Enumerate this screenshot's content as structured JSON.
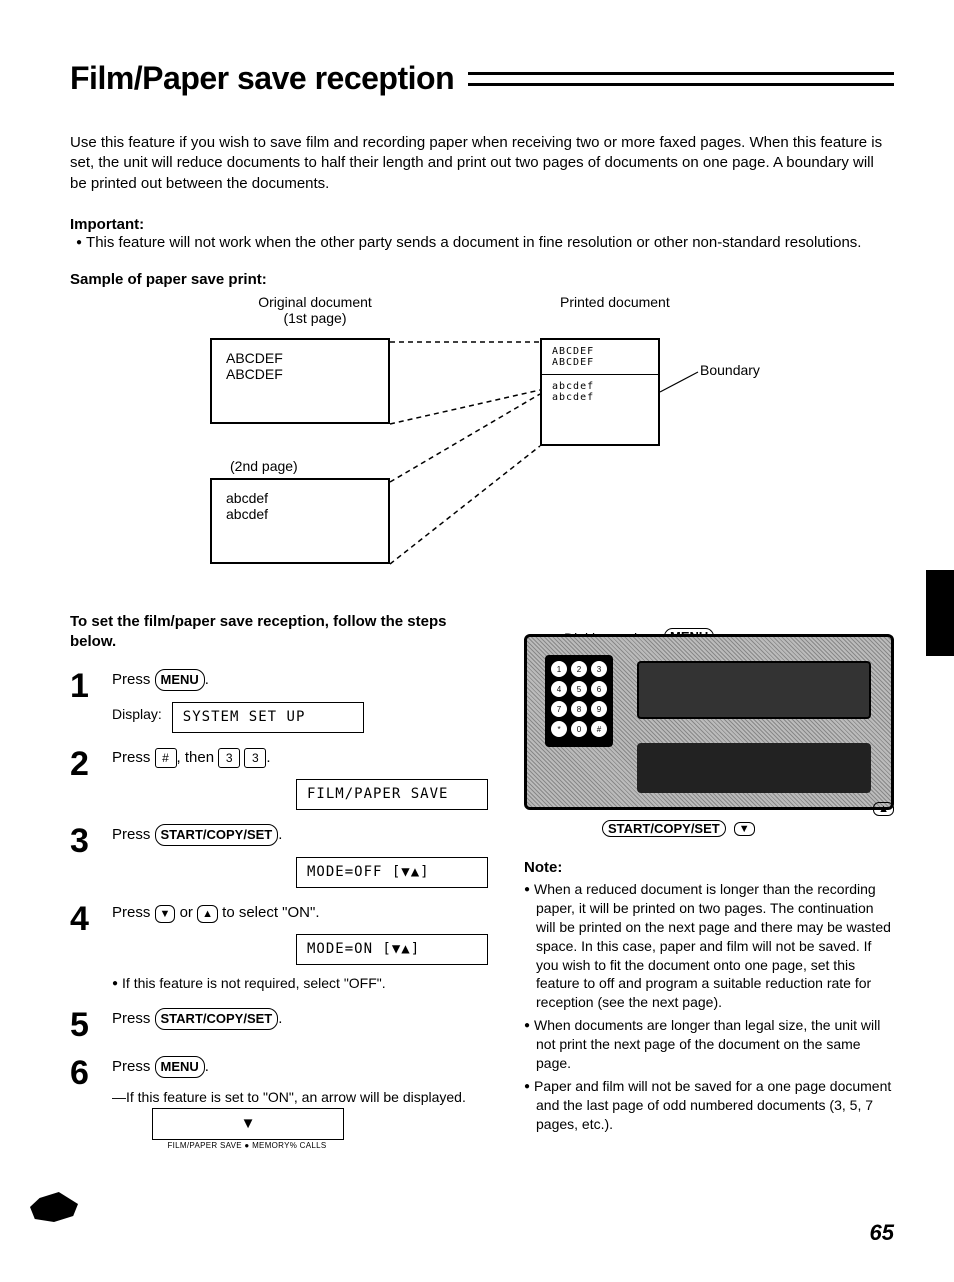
{
  "title": "Film/Paper save reception",
  "intro": "Use this feature if you wish to save film and recording paper when receiving two or more faxed pages. When this feature is set, the unit will reduce documents to half their length and print out two pages of documents on one page. A boundary will be printed out between the documents.",
  "important": {
    "label": "Important:",
    "body": "This feature will not work when the other party sends a document in fine resolution or other non-standard resolutions."
  },
  "sample": {
    "label": "Sample of paper save print:",
    "original_label": "Original document\n(1st page)",
    "printed_label": "Printed document",
    "page2_label": "(2nd page)",
    "box1_l1": "ABCDEF",
    "box1_l2": "ABCDEF",
    "box2_l1": "abcdef",
    "box2_l2": "abcdef",
    "pbox_top1": "ABCDEF",
    "pbox_top2": "ABCDEF",
    "pbox_bot1": "abcdef",
    "pbox_bot2": "abcdef",
    "boundary_label": "Boundary"
  },
  "steps_intro": "To set the film/paper save reception, follow the steps below.",
  "buttons": {
    "menu": "MENU",
    "hash": "#",
    "three": "3",
    "startcopyset": "START/COPY/SET",
    "down": "▼",
    "up": "▲"
  },
  "steps": {
    "s1": {
      "num": "1",
      "text_pre": "Press ",
      "btn": "menu",
      "text_post": ".",
      "display_label": "Display:",
      "lcd": "SYSTEM SET UP"
    },
    "s2": {
      "num": "2",
      "text": "Press # , then 3 3 .",
      "lcd": "FILM/PAPER SAVE"
    },
    "s3": {
      "num": "3",
      "text_pre": "Press ",
      "btn": "startcopyset",
      "text_post": ".",
      "lcd": "MODE=OFF    [▼▲]"
    },
    "s4": {
      "num": "4",
      "text": "Press ▼ or ▲ to select \"ON\".",
      "lcd": "MODE=ON     [▼▲]",
      "sub": "If this feature is not required, select \"OFF\"."
    },
    "s5": {
      "num": "5",
      "text_pre": "Press ",
      "btn": "startcopyset",
      "text_post": "."
    },
    "s6": {
      "num": "6",
      "text_pre": "Press ",
      "btn": "menu",
      "text_post": ".",
      "sub": "—If this feature is set to \"ON\", an arrow will be displayed.",
      "status_arrow": "▼",
      "status_sub": "FILM/PAPER SAVE ●   MEMORY%   CALLS"
    }
  },
  "device": {
    "dial_label": "Dial keypad",
    "menu_label": "MENU",
    "keypad": [
      [
        "1",
        "2",
        "3"
      ],
      [
        "4",
        "5",
        "6"
      ],
      [
        "7",
        "8",
        "9"
      ],
      [
        "*",
        "0",
        "#"
      ]
    ],
    "below_start": "START/COPY/SET"
  },
  "note": {
    "label": "Note:",
    "items": [
      "When a reduced document is longer than the recording paper, it will be printed on two pages. The continuation will be printed on the next page and there may be wasted space. In this case, paper and film will not be saved. If you wish to fit the document onto one page, set this feature to off and program a suitable reduction rate for reception (see the next page).",
      "When documents are longer than legal size, the unit will not print the next page of the document on the same page.",
      "Paper and film will not be saved for a one page document and the last page of odd numbered documents (3, 5, 7 pages, etc.)."
    ]
  },
  "page_number": "65"
}
